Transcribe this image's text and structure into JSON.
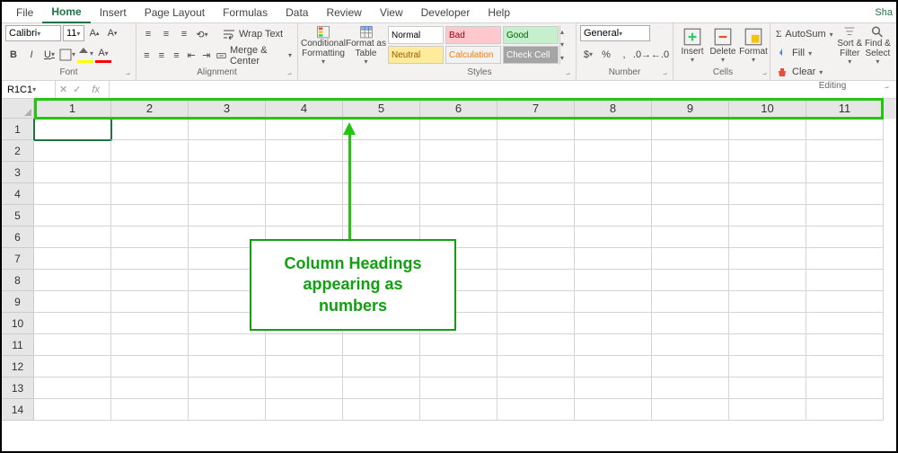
{
  "tabs": [
    "File",
    "Home",
    "Insert",
    "Page Layout",
    "Formulas",
    "Data",
    "Review",
    "View",
    "Developer",
    "Help"
  ],
  "active_tab": "Home",
  "share_label": "Sha",
  "font": {
    "name": "Calibri",
    "size": "11",
    "group_label": "Font"
  },
  "alignment": {
    "wrap": "Wrap Text",
    "merge": "Merge & Center",
    "group_label": "Alignment"
  },
  "cond_fmt": "Conditional Formatting",
  "fmt_table": "Format as Table",
  "styles": {
    "normal": "Normal",
    "bad": "Bad",
    "good": "Good",
    "neutral": "Neutral",
    "calculation": "Calculation",
    "check": "Check Cell",
    "group_label": "Styles"
  },
  "number": {
    "format": "General",
    "group_label": "Number"
  },
  "cells": {
    "insert": "Insert",
    "delete": "Delete",
    "format": "Format",
    "group_label": "Cells"
  },
  "editing": {
    "autosum": "AutoSum",
    "fill": "Fill",
    "clear": "Clear",
    "sort": "Sort & Filter",
    "find": "Find & Select",
    "group_label": "Editing"
  },
  "name_box": "R1C1",
  "col_headers": [
    "1",
    "2",
    "3",
    "4",
    "5",
    "6",
    "7",
    "8",
    "9",
    "10",
    "11"
  ],
  "row_headers": [
    "1",
    "2",
    "3",
    "4",
    "5",
    "6",
    "7",
    "8",
    "9",
    "10",
    "11",
    "12",
    "13",
    "14"
  ],
  "annotation": {
    "line1": "Column Headings",
    "line2": "appearing as numbers"
  }
}
